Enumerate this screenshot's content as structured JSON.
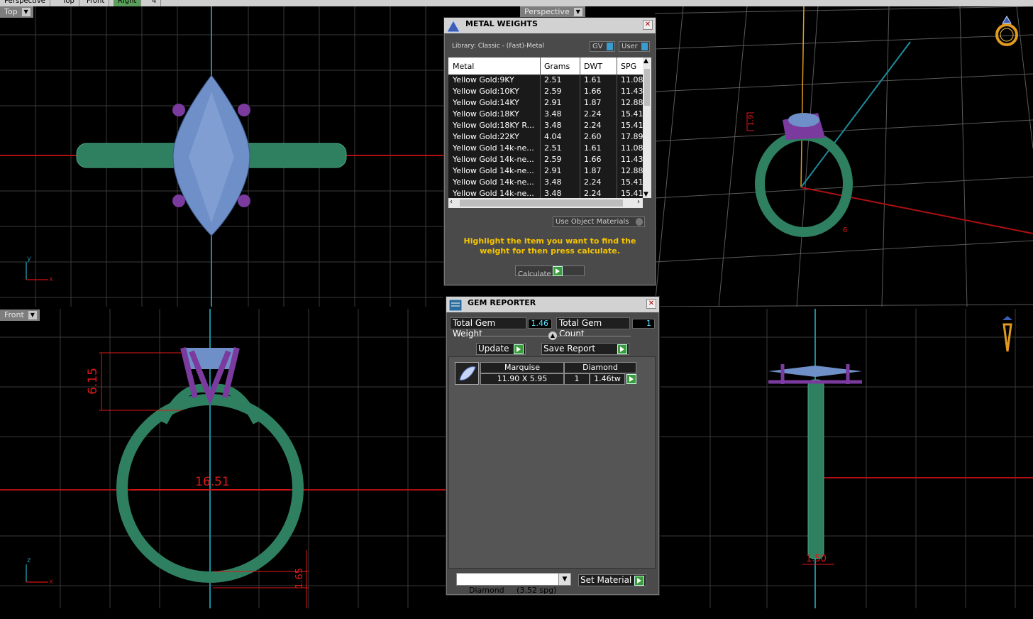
{
  "top_tabs": [
    "Perspective",
    "Top",
    "Front",
    "Right",
    "4"
  ],
  "viewports": {
    "top": {
      "label": "Top",
      "axis_y": "y",
      "axis_x": "x"
    },
    "perspective": {
      "label": "Perspective"
    },
    "front": {
      "label": "Front",
      "axis_y": "z",
      "axis_x": "x"
    },
    "right": {
      "label": "Right"
    }
  },
  "dimensions": {
    "front_height": "6.15",
    "front_width": "16.51",
    "front_bottom": "1.65",
    "right_bottom": "1.50",
    "persp_height": "1.9",
    "persp_bottom": "6"
  },
  "metal_weights": {
    "title": "METAL WEIGHTS",
    "library": "Library: Classic - (Fast)-Metal",
    "toggle_gv": "GV",
    "toggle_user": "User",
    "columns": [
      "Metal",
      "Grams",
      "DWT",
      "SPG"
    ],
    "rows": [
      [
        "Yellow Gold:9KY",
        "2.51",
        "1.61",
        "11.08"
      ],
      [
        "Yellow Gold:10KY",
        "2.59",
        "1.66",
        "11.43"
      ],
      [
        "Yellow Gold:14KY",
        "2.91",
        "1.87",
        "12.88"
      ],
      [
        "Yellow Gold:18KY",
        "3.48",
        "2.24",
        "15.41"
      ],
      [
        "Yellow Gold:18KY R...",
        "3.48",
        "2.24",
        "15.41"
      ],
      [
        "Yellow Gold:22KY",
        "4.04",
        "2.60",
        "17.89"
      ],
      [
        "Yellow Gold 14k-ne...",
        "2.51",
        "1.61",
        "11.08"
      ],
      [
        "Yellow Gold 14k-ne...",
        "2.59",
        "1.66",
        "11.43"
      ],
      [
        "Yellow Gold 14k-ne...",
        "2.91",
        "1.87",
        "12.88"
      ],
      [
        "Yellow Gold 14k-ne...",
        "3.48",
        "2.24",
        "15.41"
      ],
      [
        "Yellow Gold 14k-ne...",
        "3.48",
        "2.24",
        "15.41"
      ]
    ],
    "use_object_materials": "Use Object Materials",
    "hint": "Highlight the item you want to find the weight for then press calculate.",
    "calculate": "Calculate"
  },
  "gem_reporter": {
    "title": "GEM REPORTER",
    "total_weight_label": "Total Gem Weight",
    "total_weight_value": "1.46",
    "total_count_label": "Total Gem Count",
    "total_count_value": "1",
    "update": "Update",
    "save_report": "Save Report",
    "gems": [
      {
        "shape": "Marquise",
        "material": "Diamond",
        "size": "11.90 X 5.95",
        "count": "1",
        "weight": "1.46tw"
      }
    ],
    "material_select": "Diamond     (3.52 spg)",
    "set_material": "Set Material"
  },
  "colors": {
    "ring": "#2f8060",
    "prong": "#7a3a9e",
    "gem": "#6f8fc8",
    "dimension": "#e01818",
    "hint_text": "#f5c400",
    "value_text": "#5fe0ff"
  }
}
